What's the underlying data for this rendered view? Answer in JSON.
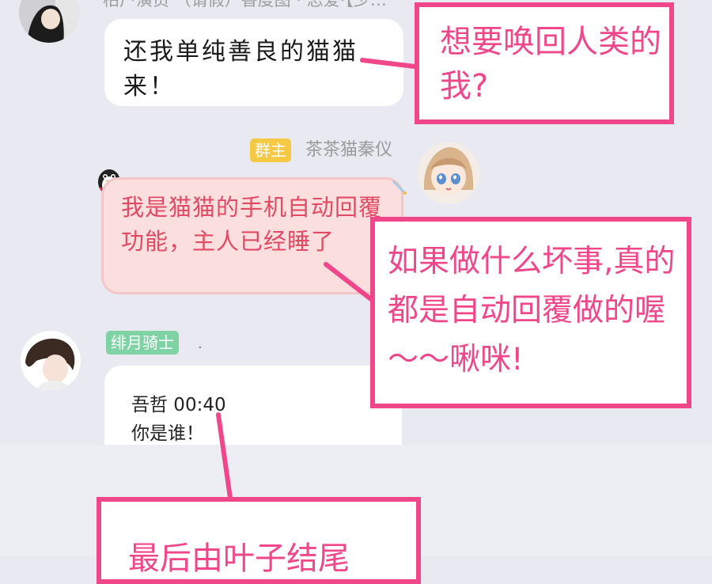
{
  "chat": {
    "top_header_clipped": "柏户演员  （请假）香度图 · 恋爱·【少…",
    "msg1": {
      "text": "还我单纯善良的猫猫来！"
    },
    "msg2": {
      "badge": "群主",
      "sender": "茶茶猫秦仪",
      "text": "我是猫猫的手机自动回覆功能，主人已经睡了"
    },
    "msg3": {
      "badge": "绯月骑士",
      "dot": ".",
      "line1": "吾哲 00:40",
      "line2": "你是谁！"
    }
  },
  "annotations": {
    "note1": "想要唤回人类的我?",
    "note2": "如果做什么坏事,真的都是自动回覆做的喔～～啾咪!",
    "note3": "最后由叶子结尾"
  },
  "colors": {
    "background": "#e9eaf1",
    "annotation_pink": "#f0478a",
    "bubble_pink": "#fbdede",
    "bubble_pink_text": "#e04a62",
    "owner_badge": "#f6c945",
    "member_badge": "#7ed2a4"
  }
}
